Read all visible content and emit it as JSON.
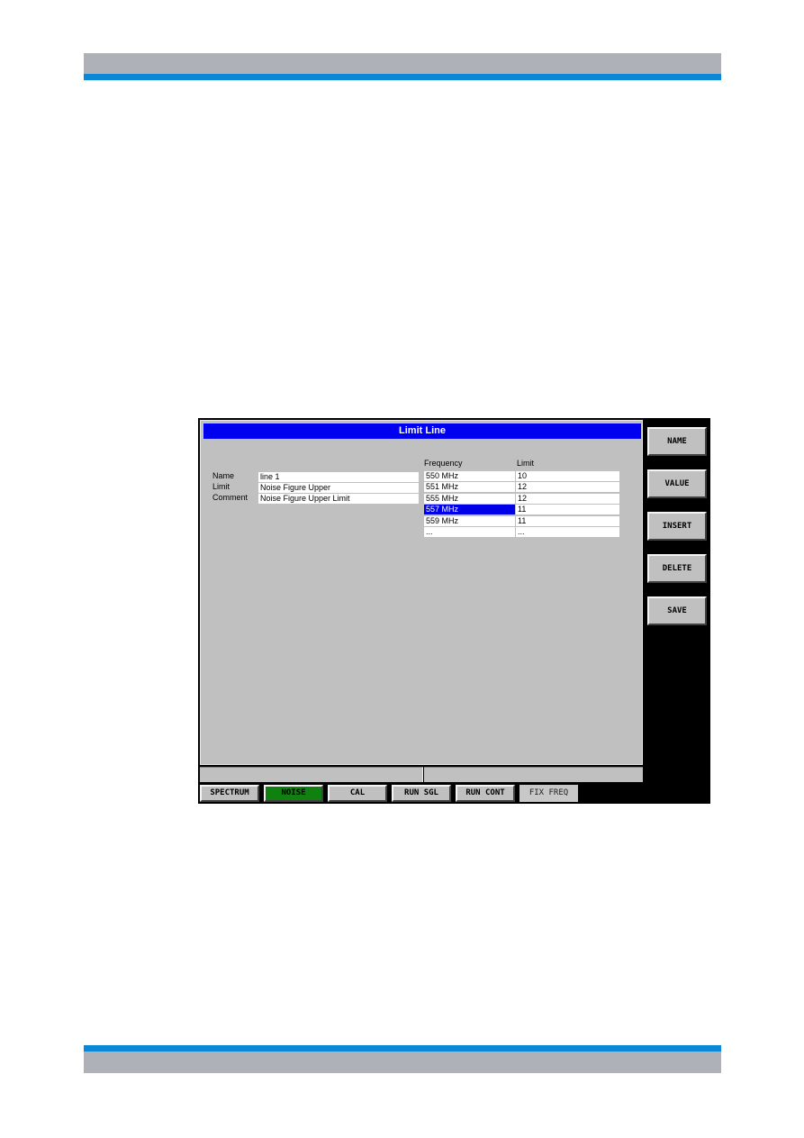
{
  "dialog": {
    "title": "Limit Line",
    "fields": [
      {
        "label": "Name",
        "value": "line 1"
      },
      {
        "label": "Limit",
        "value": "Noise Figure Upper"
      },
      {
        "label": "Comment",
        "value": "Noise Figure Upper Limit"
      }
    ],
    "table": {
      "columns": [
        "Frequency",
        "Limit"
      ],
      "rows": [
        {
          "frequency": "550 MHz",
          "limit": "10"
        },
        {
          "frequency": "551 MHz",
          "limit": "12"
        },
        {
          "frequency": "555 MHz",
          "limit": "12"
        },
        {
          "frequency": "557 MHz",
          "limit": "11",
          "selected": true
        },
        {
          "frequency": "559 MHz",
          "limit": "11"
        },
        {
          "frequency": "...",
          "limit": "..."
        }
      ]
    }
  },
  "softkeys": [
    "NAME",
    "VALUE",
    "INSERT",
    "DELETE",
    "SAVE"
  ],
  "hotkeys": [
    {
      "label": "SPECTRUM",
      "state": "normal"
    },
    {
      "label": "NOISE",
      "state": "active"
    },
    {
      "label": "CAL",
      "state": "normal"
    },
    {
      "label": "RUN SGL",
      "state": "normal"
    },
    {
      "label": "RUN CONT",
      "state": "normal"
    },
    {
      "label": "FIX FREQ",
      "state": "disabled"
    }
  ],
  "colors": {
    "title_bar": "#0000f0",
    "selection": "#0000e8",
    "active_hotkey": "#108010",
    "page_accent": "#0a88d6"
  }
}
